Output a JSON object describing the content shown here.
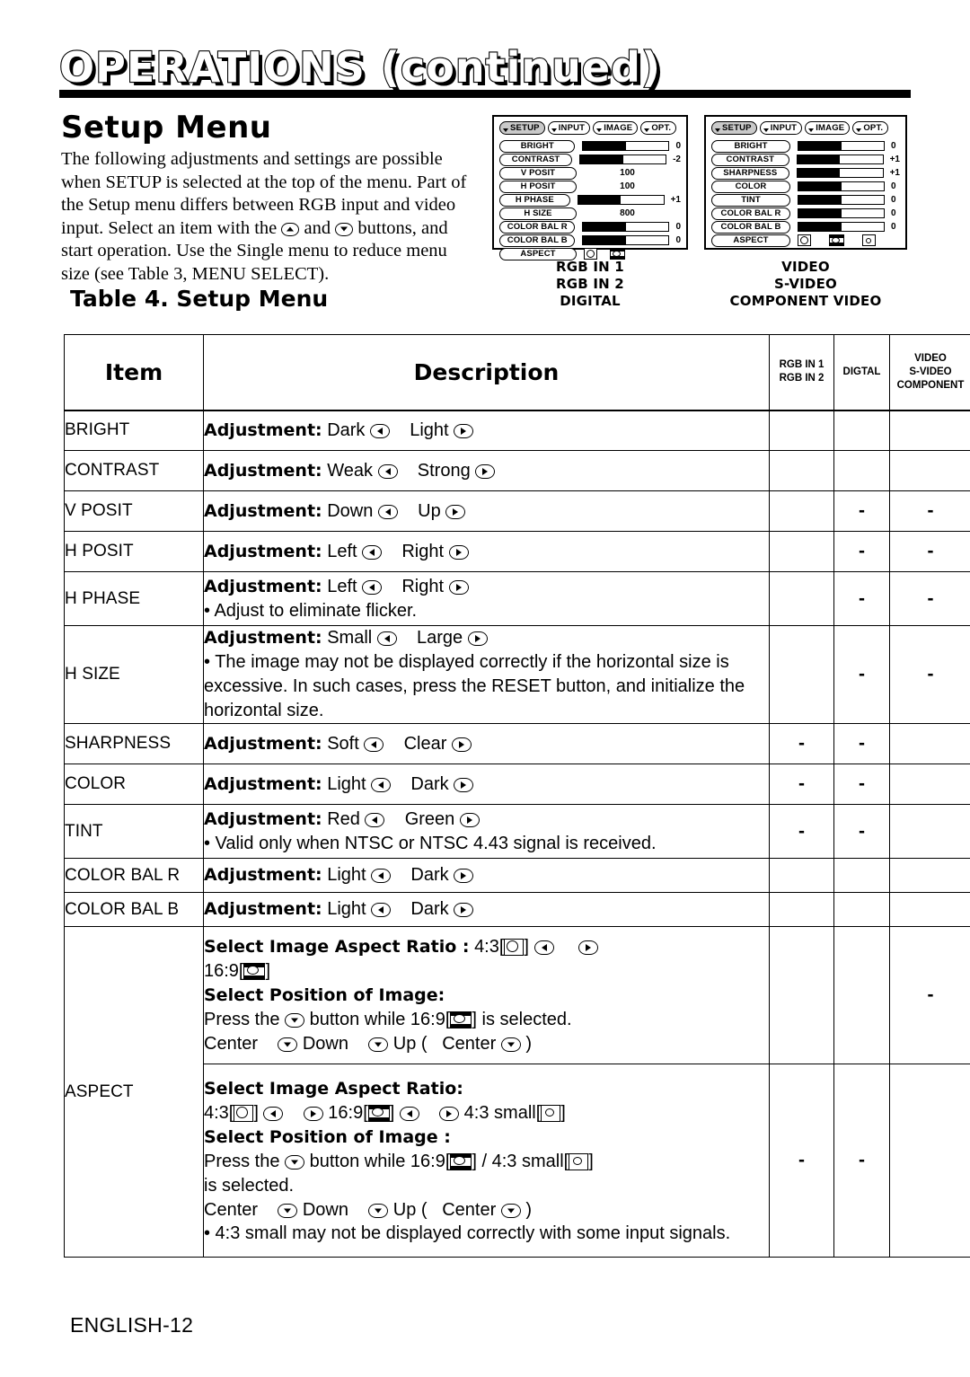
{
  "header": {
    "title": "OPERATIONS (continued)"
  },
  "section": {
    "title": "Setup Menu",
    "intro": "The following adjustments and settings are possible when SETUP is selected at the top of the menu. Part of the Setup menu differs between RGB input and video input. Select an item with the Ⓐ and Ⓕ buttons, and start operation. Use the Single menu to reduce menu size (see Table 3, MENU SELECT).",
    "table_caption": "Table 4. Setup Menu"
  },
  "osd_rgb": {
    "tabs": [
      {
        "label": "SETUP",
        "selected": true
      },
      {
        "label": "INPUT",
        "selected": false
      },
      {
        "label": "IMAGE",
        "selected": false
      },
      {
        "label": "OPT.",
        "selected": false
      }
    ],
    "rows": [
      {
        "label": "BRIGHT",
        "kind": "bar",
        "fill": 50,
        "value": "0"
      },
      {
        "label": "CONTRAST",
        "kind": "bar",
        "fill": 50,
        "value": "-2"
      },
      {
        "label": "V POSIT",
        "kind": "num",
        "value": "100"
      },
      {
        "label": "H POSIT",
        "kind": "num",
        "value": "100"
      },
      {
        "label": "H PHASE",
        "kind": "bar",
        "fill": 50,
        "value": "+1"
      },
      {
        "label": "H SIZE",
        "kind": "num",
        "value": "800"
      },
      {
        "label": "COLOR BAL R",
        "kind": "bar",
        "fill": 50,
        "value": "0"
      },
      {
        "label": "COLOR BAL B",
        "kind": "bar",
        "fill": 50,
        "value": "0"
      },
      {
        "label": "ASPECT",
        "kind": "icons",
        "icons": [
          "4:3",
          "16:9"
        ],
        "value": ""
      }
    ],
    "caption": "RGB IN 1\nRGB IN 2\nDIGITAL"
  },
  "osd_video": {
    "tabs": [
      {
        "label": "SETUP",
        "selected": true
      },
      {
        "label": "INPUT",
        "selected": false
      },
      {
        "label": "IMAGE",
        "selected": false
      },
      {
        "label": "OPT.",
        "selected": false
      }
    ],
    "rows": [
      {
        "label": "BRIGHT",
        "kind": "bar",
        "fill": 50,
        "value": "0"
      },
      {
        "label": "CONTRAST",
        "kind": "bar",
        "fill": 50,
        "value": "+1"
      },
      {
        "label": "SHARPNESS",
        "kind": "bar",
        "fill": 50,
        "value": "+1"
      },
      {
        "label": "COLOR",
        "kind": "bar",
        "fill": 50,
        "value": "0"
      },
      {
        "label": "TINT",
        "kind": "bar",
        "fill": 50,
        "value": "0"
      },
      {
        "label": "COLOR BAL  R",
        "kind": "bar",
        "fill": 50,
        "value": "0"
      },
      {
        "label": "COLOR BAL  B",
        "kind": "bar",
        "fill": 50,
        "value": "0"
      },
      {
        "label": "ASPECT",
        "kind": "icons",
        "icons": [
          "4:3",
          "16:9",
          "4:3 small"
        ],
        "value": ""
      }
    ],
    "caption": "VIDEO\nS-VIDEO\nCOMPONENT VIDEO"
  },
  "table": {
    "headers": {
      "item": "Item",
      "description": "Description",
      "col_rgb": "RGB IN 1\nRGB IN 2",
      "col_digital": "DIGTAL",
      "col_video": "VIDEO\nS-VIDEO\nCOMPONENT"
    },
    "rows": [
      {
        "item": "BRIGHT",
        "label": "Adjustment:",
        "opt_a": "Dark",
        "opt_b": "Light",
        "note": "",
        "rgb": "",
        "digital": "",
        "video": ""
      },
      {
        "item": "CONTRAST",
        "label": "Adjustment:",
        "opt_a": "Weak",
        "opt_b": "Strong",
        "note": "",
        "rgb": "",
        "digital": "",
        "video": ""
      },
      {
        "item": "V POSIT",
        "label": "Adjustment:",
        "opt_a": "Down",
        "opt_b": "Up",
        "note": "",
        "rgb": "",
        "digital": "-",
        "video": "-"
      },
      {
        "item": "H POSIT",
        "label": "Adjustment:",
        "opt_a": "Left",
        "opt_b": "Right",
        "note": "",
        "rgb": "",
        "digital": "-",
        "video": "-"
      },
      {
        "item": "H PHASE",
        "label": "Adjustment:",
        "opt_a": "Left",
        "opt_b": "Right",
        "note": "• Adjust to eliminate flicker.",
        "rgb": "",
        "digital": "-",
        "video": "-"
      },
      {
        "item": "H SIZE",
        "label": "Adjustment:",
        "opt_a": "Small",
        "opt_b": "Large",
        "note": "• The image may not be displayed correctly if the horizontal size is excessive. In such cases, press the RESET button, and initialize the horizontal size.",
        "rgb": "",
        "digital": "-",
        "video": "-"
      },
      {
        "item": "SHARPNESS",
        "label": "Adjustment:",
        "opt_a": "Soft",
        "opt_b": "Clear",
        "note": "",
        "rgb": "-",
        "digital": "-",
        "video": ""
      },
      {
        "item": "COLOR",
        "label": "Adjustment:",
        "opt_a": "Light",
        "opt_b": "Dark",
        "note": "",
        "rgb": "-",
        "digital": "-",
        "video": ""
      },
      {
        "item": "TINT",
        "label": "Adjustment:",
        "opt_a": "Red",
        "opt_b": "Green",
        "note": "• Valid only when NTSC or NTSC 4.43 signal is received.",
        "rgb": "-",
        "digital": "-",
        "video": ""
      },
      {
        "item": "COLOR BAL R",
        "label": "Adjustment:",
        "opt_a": "Light",
        "opt_b": "Dark",
        "note": "",
        "rgb": "",
        "digital": "",
        "video": ""
      },
      {
        "item": "COLOR BAL B",
        "label": "Adjustment:",
        "opt_a": "Light",
        "opt_b": "Dark",
        "note": "",
        "rgb": "",
        "digital": "",
        "video": ""
      }
    ],
    "aspect": {
      "item": "ASPECT",
      "block1": {
        "heading_ratio": "Select Image Aspect Ratio :",
        "ratio_a": "4:3[",
        "ratio_a_end": "]",
        "ratio_b": "16:9[",
        "ratio_b_end": "]",
        "heading_position": "Select Position of Image:",
        "press_pre": "Press the",
        "press_mid": "button while 16:9[",
        "press_post": "] is selected.",
        "center": "Center",
        "down": "Down",
        "up": "Up (",
        "center2": "Center",
        "close": ")",
        "rgb": "",
        "digital": "",
        "video": "-"
      },
      "block2": {
        "heading_ratio": "Select Image Aspect Ratio:",
        "ratio_a": "4:3[",
        "ratio_a_end": "]",
        "ratio_b": "16:9[",
        "ratio_b_end": "]",
        "ratio_c": "4:3 small[",
        "ratio_c_end": "]",
        "heading_position": "Select Position of Image :",
        "press_pre": "Press the",
        "press_mid": "button while 16:9[",
        "press_mid2": "] / 4:3 small[",
        "press_post": "]",
        "press_line2": "is selected.",
        "center": "Center",
        "down": "Down",
        "up": "Up (",
        "center2": "Center",
        "close": ")",
        "note": "• 4:3 small may not be displayed correctly with some input signals.",
        "rgb": "-",
        "digital": "-",
        "video": ""
      }
    }
  },
  "footer": {
    "page": "ENGLISH-12"
  }
}
